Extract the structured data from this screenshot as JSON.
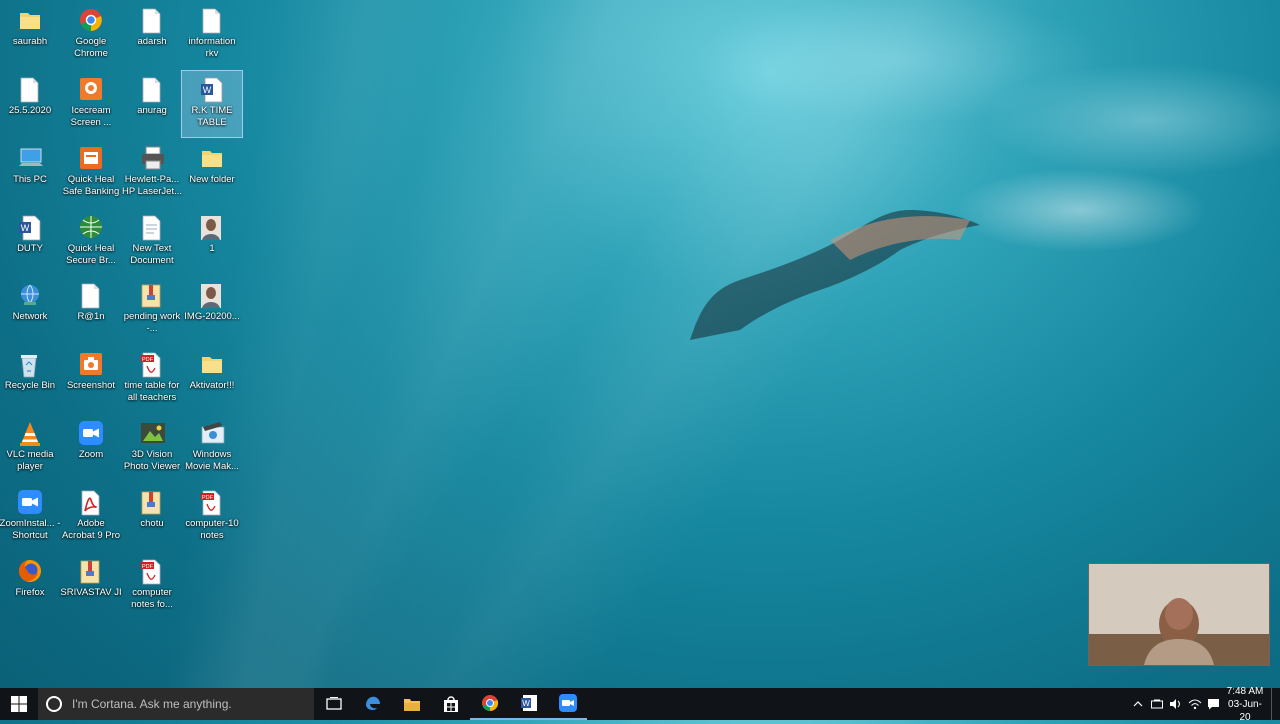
{
  "desktop": {
    "icons": [
      {
        "label": "saurabh",
        "icon": "folder-icon"
      },
      {
        "label": "Google Chrome",
        "icon": "chrome-icon"
      },
      {
        "label": "adarsh",
        "icon": "document-icon"
      },
      {
        "label": "information rkv",
        "icon": "document-icon"
      },
      {
        "label": "25.5.2020",
        "icon": "document-icon"
      },
      {
        "label": "Icecream Screen ...",
        "icon": "icecream-recorder-icon"
      },
      {
        "label": "anurag",
        "icon": "document-icon"
      },
      {
        "label": "R.K TIME TABLE",
        "icon": "word-document-icon"
      },
      {
        "label": "This PC",
        "icon": "computer-icon"
      },
      {
        "label": "Quick Heal Safe Banking",
        "icon": "quickheal-banking-icon"
      },
      {
        "label": "Hewlett-Pa... HP LaserJet...",
        "icon": "printer-icon"
      },
      {
        "label": "New folder",
        "icon": "folder-icon"
      },
      {
        "label": "DUTY",
        "icon": "word-document-icon"
      },
      {
        "label": "Quick Heal Secure Br...",
        "icon": "quickheal-browser-icon"
      },
      {
        "label": "New Text Document",
        "icon": "text-document-icon"
      },
      {
        "label": "1",
        "icon": "image-icon"
      },
      {
        "label": "Network",
        "icon": "network-icon"
      },
      {
        "label": "R@1n",
        "icon": "document-icon"
      },
      {
        "label": "pending work -...",
        "icon": "archive-icon"
      },
      {
        "label": "IMG-20200...",
        "icon": "image-icon"
      },
      {
        "label": "Recycle Bin",
        "icon": "recycle-bin-icon"
      },
      {
        "label": "Screenshot",
        "icon": "screenshot-app-icon"
      },
      {
        "label": "time table for all teachers",
        "icon": "pdf-icon"
      },
      {
        "label": "Aktivator!!!",
        "icon": "folder-icon"
      },
      {
        "label": "VLC media player",
        "icon": "vlc-icon"
      },
      {
        "label": "Zoom",
        "icon": "zoom-icon"
      },
      {
        "label": "3D Vision Photo Viewer",
        "icon": "photo-viewer-icon"
      },
      {
        "label": "Windows Movie Mak...",
        "icon": "movie-maker-icon"
      },
      {
        "label": "ZoomInstal... - Shortcut",
        "icon": "zoom-icon"
      },
      {
        "label": "Adobe Acrobat 9 Pro",
        "icon": "acrobat-icon"
      },
      {
        "label": "chotu",
        "icon": "archive-icon"
      },
      {
        "label": "computer-10 notes",
        "icon": "pdf-icon"
      },
      {
        "label": "Firefox",
        "icon": "firefox-icon"
      },
      {
        "label": "SRIVASTAV JI",
        "icon": "archive-icon"
      },
      {
        "label": "computer notes fo...",
        "icon": "pdf-icon"
      }
    ]
  },
  "taskbar": {
    "cortana_placeholder": "I'm Cortana. Ask me anything.",
    "pinned": [
      "task-view-icon",
      "edge-icon",
      "file-explorer-icon",
      "store-icon",
      "chrome-icon",
      "word-icon",
      "zoom-icon"
    ],
    "clock_time": "7:48 AM",
    "clock_date": "03-Jun-20"
  },
  "colors": {
    "taskbar_bg": "#101418",
    "selection": "#aad2f0",
    "water": "#15879f"
  }
}
